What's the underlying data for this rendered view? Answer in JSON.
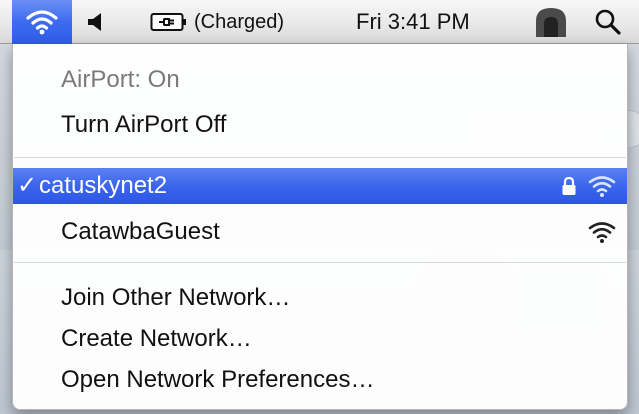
{
  "menubar": {
    "battery_status": "(Charged)",
    "clock": "Fri 3:41 PM"
  },
  "airport_menu": {
    "status": "AirPort: On",
    "toggle_label": "Turn AirPort Off",
    "networks": [
      {
        "name": "catuskynet2",
        "selected": true,
        "locked": true
      },
      {
        "name": "CatawbaGuest",
        "selected": false,
        "locked": false
      }
    ],
    "actions": [
      "Join Other Network…",
      "Create Network…",
      "Open Network Preferences…"
    ],
    "checkmark": "✓"
  },
  "colors": {
    "highlight": "#3b65ec",
    "menubar": "#e9e9e9"
  }
}
